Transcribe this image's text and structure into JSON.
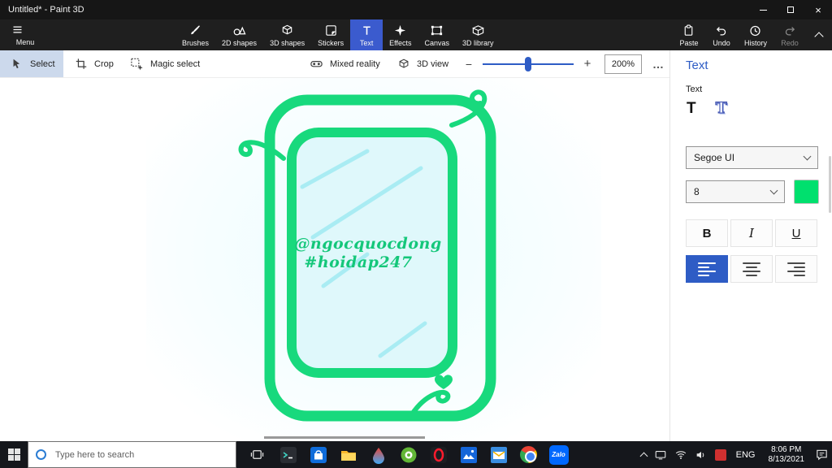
{
  "colors": {
    "accent": "#2e5cc5",
    "tab": "#3b5bce",
    "green": "#18d97d",
    "green-text": "#14c77a",
    "canvas-fill": "#dff8fb",
    "canvas-stroke": "#a9ecf3",
    "swatch": "#00e06e"
  },
  "window": {
    "title": "Untitled* - Paint 3D"
  },
  "icons": {
    "close": "×",
    "minus": "−",
    "plus": "+",
    "more": "…"
  },
  "ribbon": {
    "menu": "Menu",
    "tools": [
      {
        "label": "Brushes"
      },
      {
        "label": "2D shapes"
      },
      {
        "label": "3D shapes"
      },
      {
        "label": "Stickers"
      },
      {
        "label": "Text"
      },
      {
        "label": "Effects"
      },
      {
        "label": "Canvas"
      },
      {
        "label": "3D library"
      }
    ],
    "actions": [
      {
        "label": "Paste"
      },
      {
        "label": "Undo"
      },
      {
        "label": "History"
      },
      {
        "label": "Redo"
      }
    ]
  },
  "toolbar": {
    "select": "Select",
    "crop": "Crop",
    "magic_select": "Magic select",
    "mixed_reality": "Mixed reality",
    "view_3d": "3D view",
    "zoom": "200%"
  },
  "panel": {
    "title": "Text",
    "section": "Text",
    "font": "Segoe UI",
    "size": "8",
    "bold": "B",
    "italic": "I",
    "underline": "U"
  },
  "canvas": {
    "line1": "@ngocquocdong",
    "line2": "#hoidap247"
  },
  "taskbar": {
    "search_placeholder": "Type here to search",
    "zalo": "Zalo",
    "language": "ENG",
    "time": "8:06 PM",
    "date": "8/13/2021"
  }
}
